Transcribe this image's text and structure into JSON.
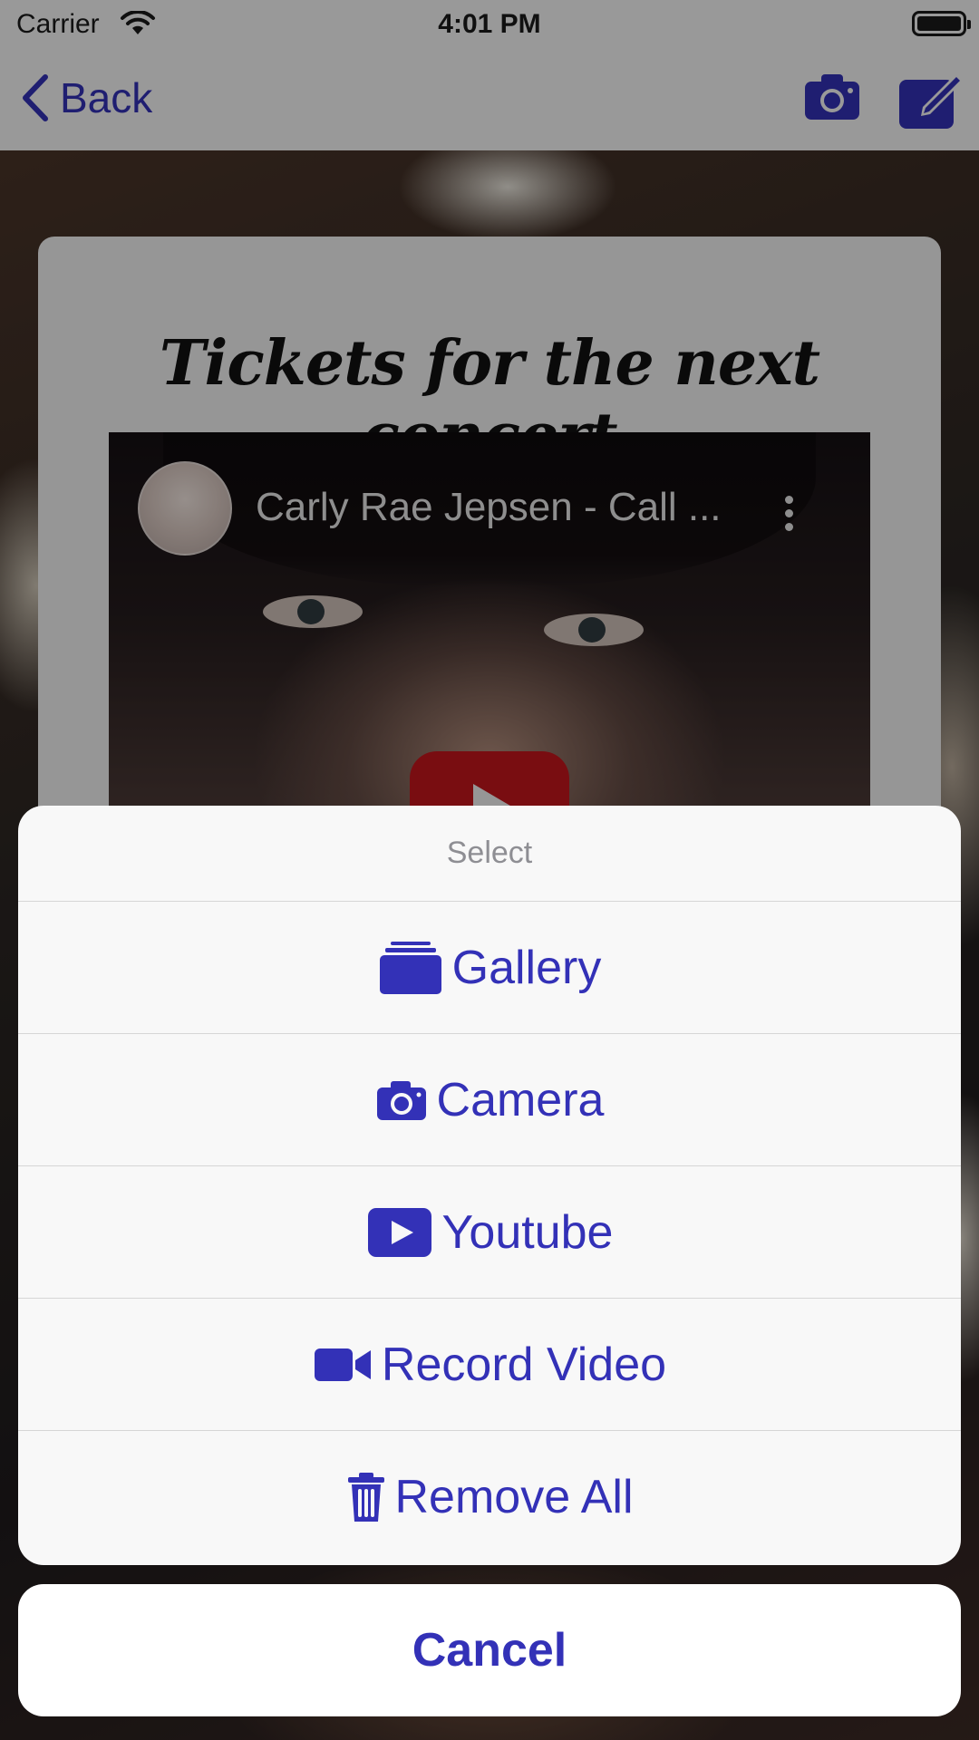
{
  "status_bar": {
    "carrier": "Carrier",
    "time": "4:01 PM"
  },
  "nav": {
    "back_label": "Back"
  },
  "card": {
    "title": "Tickets for the next concert",
    "video": {
      "title": "Carly Rae Jepsen - Call ..."
    }
  },
  "action_sheet": {
    "title": "Select",
    "options": [
      {
        "label": "Gallery",
        "icon": "gallery-icon"
      },
      {
        "label": "Camera",
        "icon": "camera-icon"
      },
      {
        "label": "Youtube",
        "icon": "youtube-icon"
      },
      {
        "label": "Record Video",
        "icon": "video-camera-icon"
      },
      {
        "label": "Remove All",
        "icon": "trash-icon"
      }
    ],
    "cancel_label": "Cancel"
  },
  "colors": {
    "accent": "#3331b7",
    "youtube_red": "#c4161c",
    "sheet_bg": "#f8f8f8"
  }
}
